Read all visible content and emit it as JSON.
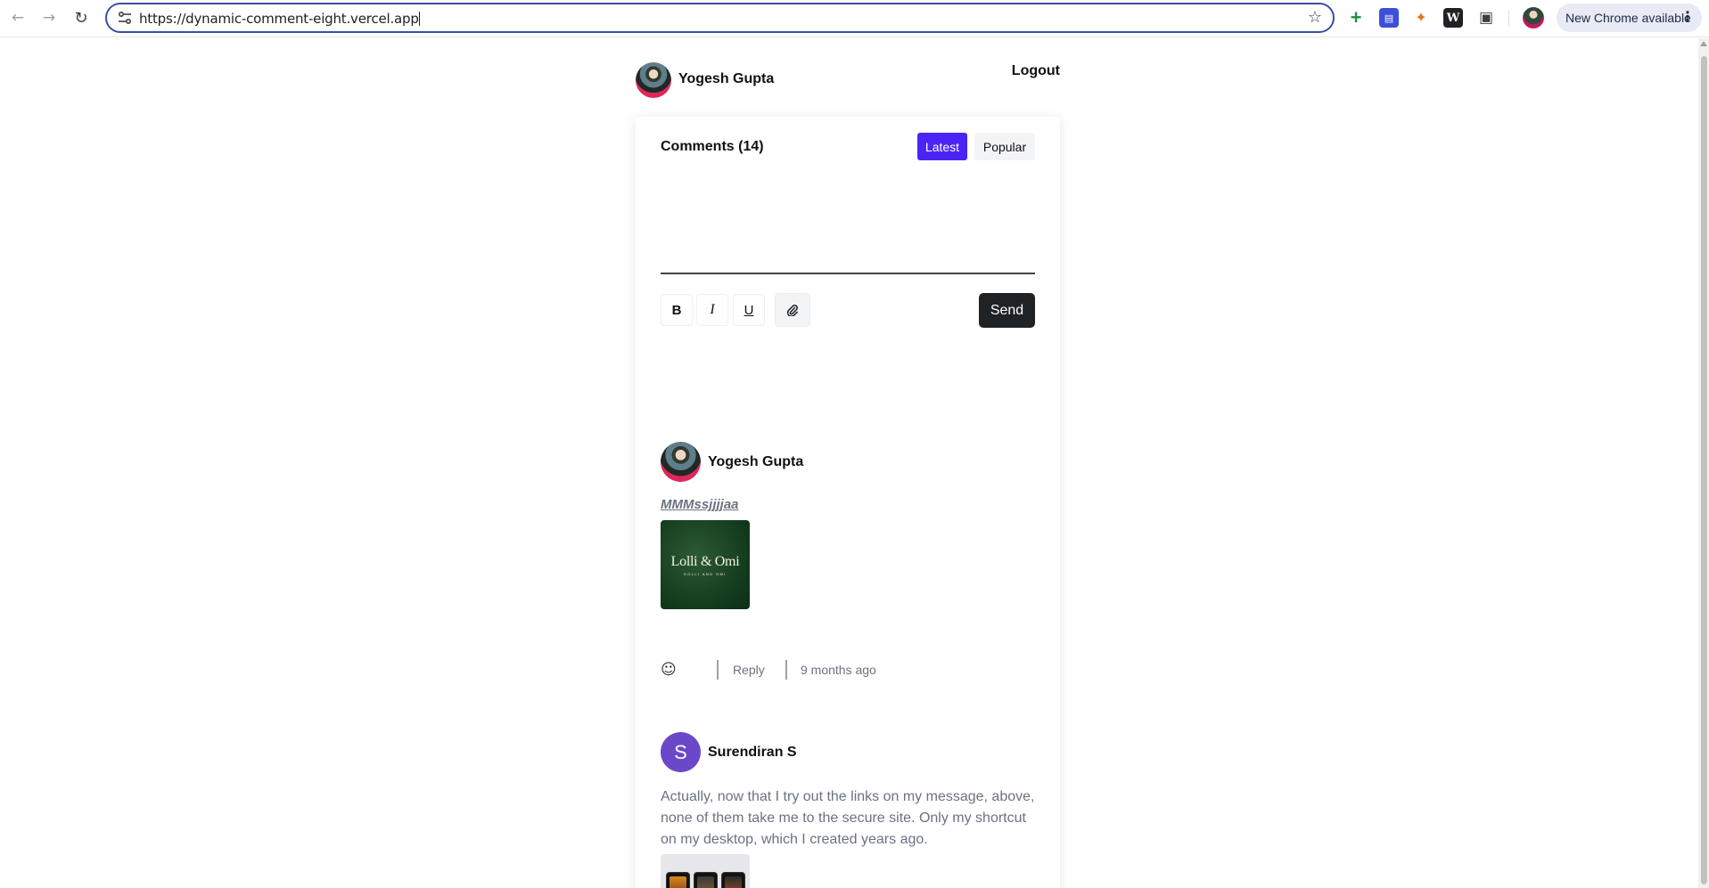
{
  "browser": {
    "url": "https://dynamic-comment-eight.vercel.app",
    "update_label": "New Chrome available"
  },
  "header": {
    "user_name": "Yogesh Gupta",
    "logout_label": "Logout"
  },
  "comments_panel": {
    "title": "Comments (14)",
    "tabs": [
      {
        "label": "Latest",
        "active": true
      },
      {
        "label": "Popular",
        "active": false
      }
    ],
    "toolbar": {
      "bold": "B",
      "italic": "I",
      "underline": "U",
      "send_label": "Send"
    }
  },
  "comments": [
    {
      "author": "Yogesh Gupta",
      "avatar": "photo",
      "text": "MMMssjjjjaa",
      "attachment": {
        "logo_text": "Lolli & Omi",
        "logo_subtext": "KOLLI AND OMI"
      },
      "reply_label": "Reply",
      "time": "9 months ago"
    },
    {
      "author": "Surendiran S",
      "avatar_initial": "S",
      "text": "Actually, now that I try out the links on my message, above, none of them take me to the secure site. Only my shortcut on my desktop, which I created years ago."
    }
  ],
  "colors": {
    "accent": "#4b24f5",
    "send_button": "#1f2326",
    "initial_avatar": "#6b48c9"
  }
}
